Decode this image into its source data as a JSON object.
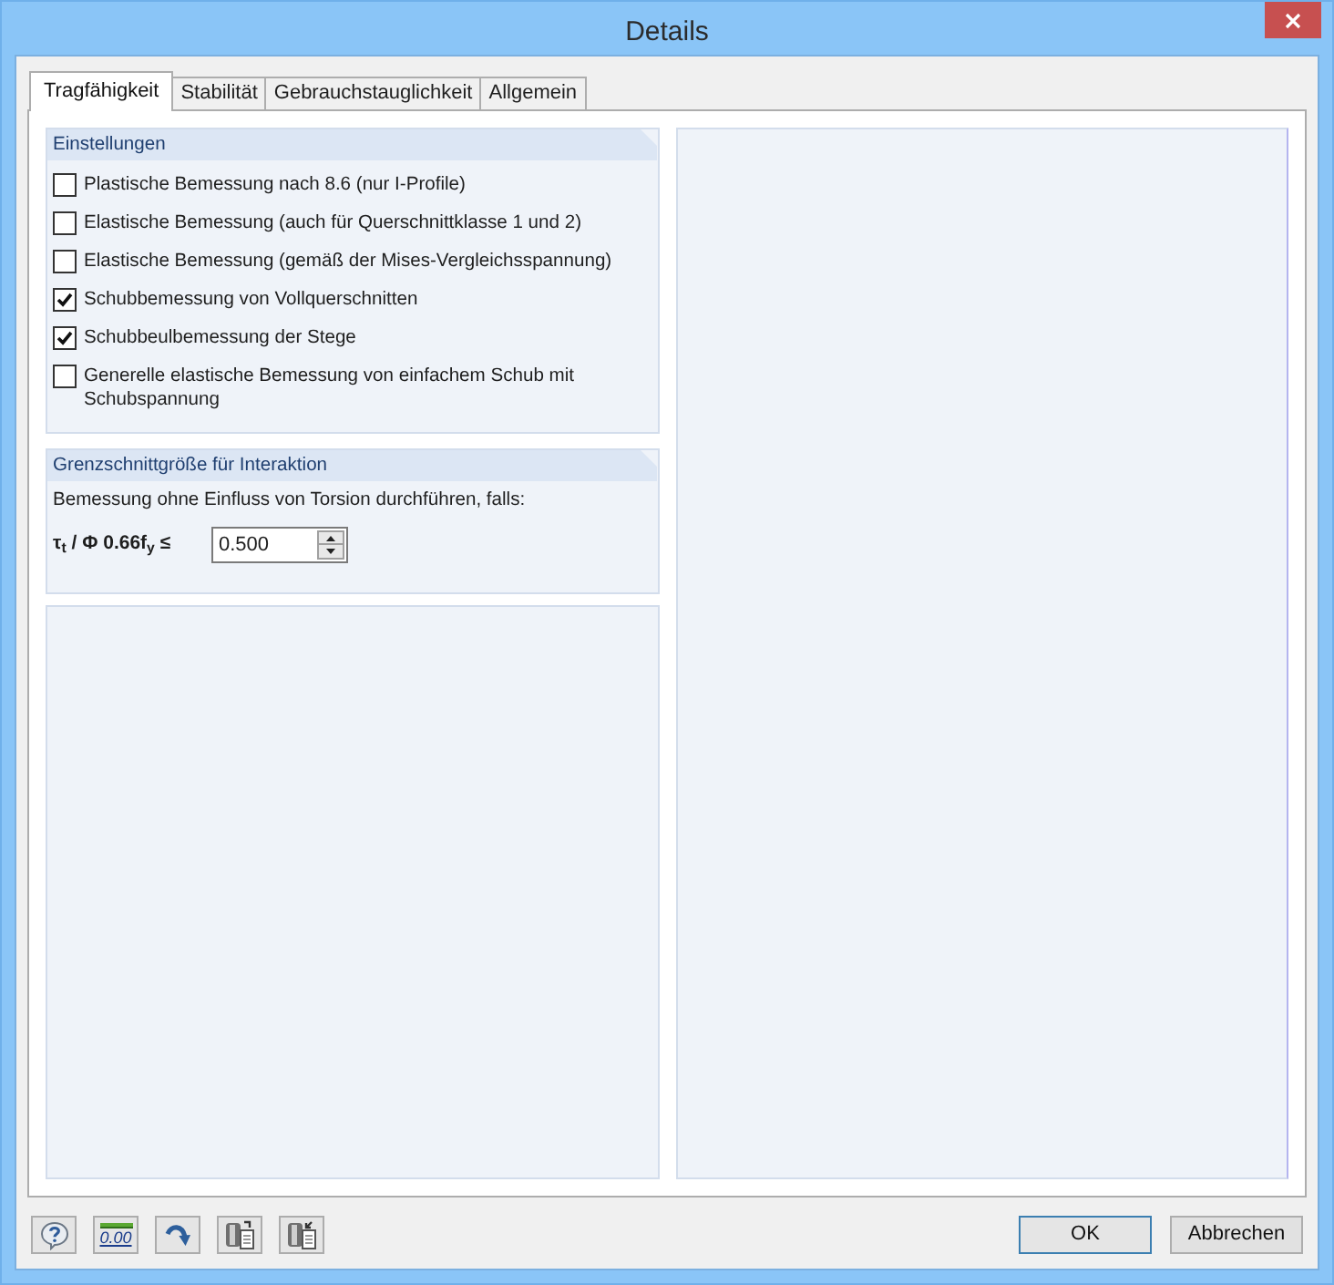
{
  "window": {
    "title": "Details"
  },
  "tabs": [
    {
      "label": "Tragfähigkeit",
      "selected": true
    },
    {
      "label": "Stabilität",
      "selected": false
    },
    {
      "label": "Gebrauchstauglichkeit",
      "selected": false
    },
    {
      "label": "Allgemein",
      "selected": false
    }
  ],
  "settings": {
    "title": "Einstellungen",
    "options": [
      {
        "label": "Plastische Bemessung nach 8.6 (nur I-Profile)",
        "checked": false
      },
      {
        "label": "Elastische Bemessung (auch für Querschnittklasse 1 und 2)",
        "checked": false
      },
      {
        "label": "Elastische Bemessung (gemäß der Mises-Vergleichsspannung)",
        "checked": false
      },
      {
        "label": "Schubbemessung von Vollquerschnitten",
        "checked": true
      },
      {
        "label": "Schubbeulbemessung der Stege",
        "checked": true
      },
      {
        "label": "Generelle elastische Bemessung von einfachem Schub mit Schubspannung",
        "checked": false
      }
    ]
  },
  "interaction": {
    "title": "Grenzschnittgröße für Interaktion",
    "description": "Bemessung ohne Einfluss von Torsion durchführen, falls:",
    "formula": "τ$_{t}$ / Φ 0.66f$_{y}$ ≤",
    "value": "0.500"
  },
  "toolbar": [
    {
      "kind": "help"
    },
    {
      "kind": "decimals",
      "label": "0.00"
    },
    {
      "kind": "arrow"
    },
    {
      "kind": "export"
    },
    {
      "kind": "import"
    }
  ],
  "buttons": [
    {
      "label": "OK",
      "default": true
    },
    {
      "label": "Abbrechen",
      "default": false
    }
  ]
}
